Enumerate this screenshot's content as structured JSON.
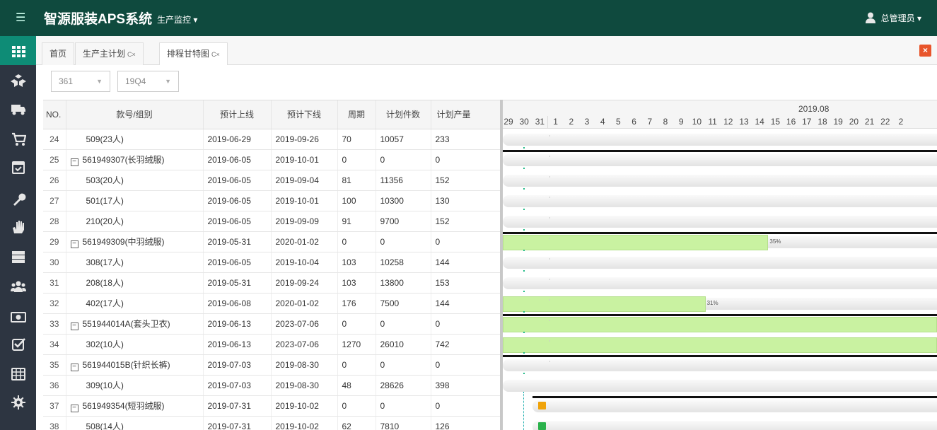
{
  "app": {
    "title": "智源服装APS系统",
    "module": "生产监控 ▾",
    "user": "总管理员 ▾"
  },
  "tabs": [
    {
      "label": "首页",
      "actions": ""
    },
    {
      "label": "生产主计划",
      "actions": "C×"
    },
    {
      "label": "排程甘特图",
      "actions": "C×"
    }
  ],
  "filters": [
    {
      "value": "361"
    },
    {
      "value": "19Q4"
    }
  ],
  "grid": {
    "columns": [
      "NO.",
      "款号/组别",
      "预计上线",
      "预计下线",
      "周期",
      "计划件数",
      "计划产量"
    ],
    "rows": [
      {
        "no": "24",
        "name": "509(23人)",
        "group": false,
        "start": "2019-06-29",
        "end": "2019-09-26",
        "cycle": "70",
        "qty": "10057",
        "output": "233"
      },
      {
        "no": "25",
        "name": "561949307(长羽绒服)",
        "group": true,
        "start": "2019-06-05",
        "end": "2019-10-01",
        "cycle": "0",
        "qty": "0",
        "output": "0"
      },
      {
        "no": "26",
        "name": "503(20人)",
        "group": false,
        "start": "2019-06-05",
        "end": "2019-09-04",
        "cycle": "81",
        "qty": "11356",
        "output": "152"
      },
      {
        "no": "27",
        "name": "501(17人)",
        "group": false,
        "start": "2019-06-05",
        "end": "2019-10-01",
        "cycle": "100",
        "qty": "10300",
        "output": "130"
      },
      {
        "no": "28",
        "name": "210(20人)",
        "group": false,
        "start": "2019-06-05",
        "end": "2019-09-09",
        "cycle": "91",
        "qty": "9700",
        "output": "152"
      },
      {
        "no": "29",
        "name": "561949309(中羽绒服)",
        "group": true,
        "start": "2019-05-31",
        "end": "2020-01-02",
        "cycle": "0",
        "qty": "0",
        "output": "0"
      },
      {
        "no": "30",
        "name": "308(17人)",
        "group": false,
        "start": "2019-06-05",
        "end": "2019-10-04",
        "cycle": "103",
        "qty": "10258",
        "output": "144"
      },
      {
        "no": "31",
        "name": "208(18人)",
        "group": false,
        "start": "2019-05-31",
        "end": "2019-09-24",
        "cycle": "103",
        "qty": "13800",
        "output": "153"
      },
      {
        "no": "32",
        "name": "402(17人)",
        "group": false,
        "start": "2019-06-08",
        "end": "2020-01-02",
        "cycle": "176",
        "qty": "7500",
        "output": "144"
      },
      {
        "no": "33",
        "name": "551944014A(套头卫衣)",
        "group": true,
        "start": "2019-06-13",
        "end": "2023-07-06",
        "cycle": "0",
        "qty": "0",
        "output": "0"
      },
      {
        "no": "34",
        "name": "302(10人)",
        "group": false,
        "start": "2019-06-13",
        "end": "2023-07-06",
        "cycle": "1270",
        "qty": "26010",
        "output": "742"
      },
      {
        "no": "35",
        "name": "561944015B(针织长裤)",
        "group": true,
        "start": "2019-07-03",
        "end": "2019-08-30",
        "cycle": "0",
        "qty": "0",
        "output": "0"
      },
      {
        "no": "36",
        "name": "309(10人)",
        "group": false,
        "start": "2019-07-03",
        "end": "2019-08-30",
        "cycle": "48",
        "qty": "28626",
        "output": "398"
      },
      {
        "no": "37",
        "name": "561949354(短羽绒服)",
        "group": true,
        "start": "2019-07-31",
        "end": "2019-10-02",
        "cycle": "0",
        "qty": "0",
        "output": "0"
      },
      {
        "no": "38",
        "name": "508(14人)",
        "group": false,
        "start": "2019-07-31",
        "end": "2019-10-02",
        "cycle": "62",
        "qty": "7810",
        "output": "126"
      }
    ]
  },
  "gantt": {
    "month": "2019.08",
    "days": [
      "29",
      "30",
      "31",
      "1",
      "2",
      "3",
      "4",
      "5",
      "6",
      "7",
      "8",
      "9",
      "10",
      "11",
      "12",
      "13",
      "14",
      "15",
      "16",
      "17",
      "18",
      "19",
      "20",
      "21",
      "22",
      "2"
    ],
    "bars": [
      {
        "row": "24",
        "summary": false,
        "progress_end_day": null,
        "pct_label": ""
      },
      {
        "row": "25",
        "summary": true,
        "progress_end_day": null,
        "pct_label": ""
      },
      {
        "row": "26",
        "summary": false,
        "progress_end_day": null,
        "pct_label": ""
      },
      {
        "row": "27",
        "summary": false,
        "progress_end_day": null,
        "pct_label": ""
      },
      {
        "row": "28",
        "summary": false,
        "progress_end_day": null,
        "pct_label": ""
      },
      {
        "row": "29",
        "summary": true,
        "progress_end_day": "15",
        "pct_label": "35%"
      },
      {
        "row": "30",
        "summary": false,
        "progress_end_day": null,
        "pct_label": ""
      },
      {
        "row": "31",
        "summary": false,
        "progress_end_day": null,
        "pct_label": ""
      },
      {
        "row": "32",
        "summary": false,
        "progress_end_day": "11",
        "pct_label": "31%"
      },
      {
        "row": "33",
        "summary": true,
        "progress_end_day": "end",
        "pct_label": ""
      },
      {
        "row": "34",
        "summary": false,
        "progress_end_day": "end",
        "pct_label": ""
      },
      {
        "row": "35",
        "summary": true,
        "progress_end_day": null,
        "pct_label": ""
      },
      {
        "row": "36",
        "summary": false,
        "progress_end_day": null,
        "pct_label": ""
      },
      {
        "row": "37",
        "summary": true,
        "progress_end_day": null,
        "pct_label": "",
        "marker_color": "#f0a30a"
      },
      {
        "row": "38",
        "summary": false,
        "progress_end_day": null,
        "pct_label": "",
        "marker_color": "#2bb24c"
      }
    ]
  },
  "colors": {
    "topbar": "#0f4a3e",
    "sidebar": "#2d3541",
    "sidebar_active": "#0e8c76",
    "progress": "#c9f2a1",
    "close_all": "#e8552b"
  },
  "sidebar_icons": [
    "grid-icon",
    "cubes-icon",
    "truck-icon",
    "cart-icon",
    "calendar-check-icon",
    "wrench-icon",
    "hand-icon",
    "server-icon",
    "users-icon",
    "money-icon",
    "checkbox-icon",
    "table-icon",
    "gear-icon"
  ]
}
